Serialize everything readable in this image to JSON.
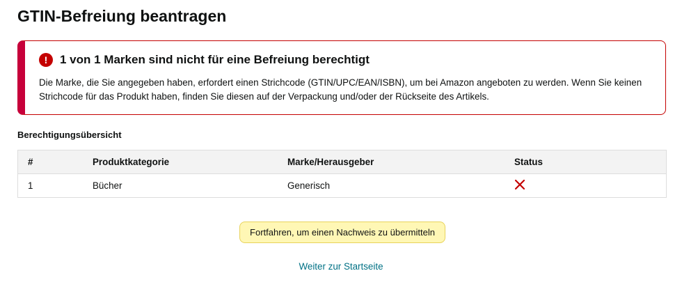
{
  "page": {
    "title": "GTIN-Befreiung beantragen"
  },
  "alert": {
    "icon": "error-icon",
    "heading": "1 von 1 Marken sind nicht für eine Befreiung berechtigt",
    "body": "Die Marke, die Sie angegeben haben, erfordert einen Strichcode (GTIN/UPC/EAN/ISBN), um bei Amazon angeboten zu werden. Wenn Sie keinen Strichcode für das Produkt haben, finden Sie diesen auf der Verpackung und/oder der Rückseite des Artikels.",
    "accent": "#c7003a"
  },
  "overview": {
    "label": "Berechtigungsübersicht",
    "columns": [
      "#",
      "Produktkategorie",
      "Marke/Herausgeber",
      "Status"
    ],
    "rows": [
      {
        "num": "1",
        "category": "Bücher",
        "brand": "Generisch",
        "status_icon": "x-icon",
        "status_color": "#c40000"
      }
    ]
  },
  "actions": {
    "continue_label": "Fortfahren, um einen Nachweis zu übermitteln",
    "home_link": "Weiter zur Startseite",
    "link_color": "#007185"
  }
}
